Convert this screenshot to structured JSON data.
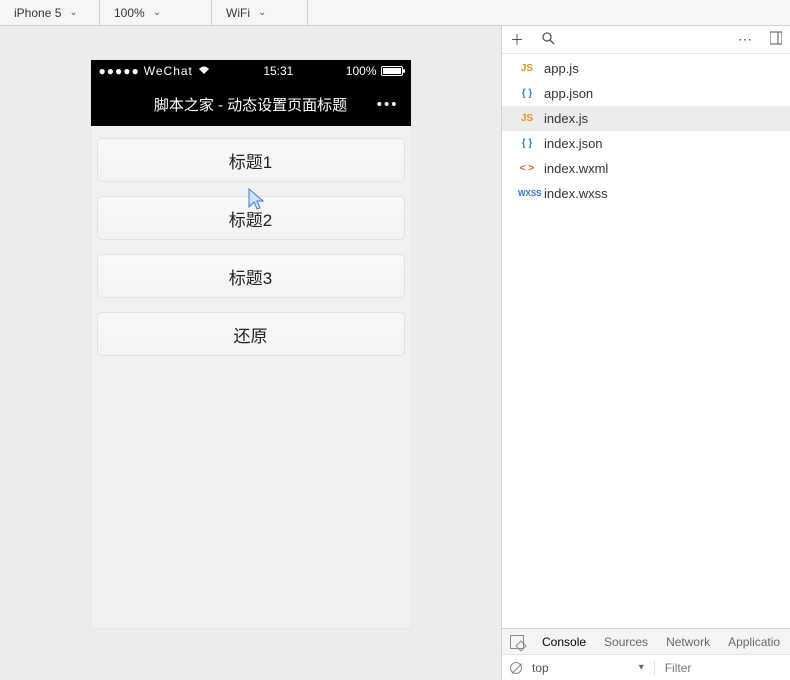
{
  "toolbar": {
    "device": "iPhone 5",
    "zoom": "100%",
    "network": "WiFi"
  },
  "statusbar": {
    "carrier": "WeChat",
    "time": "15:31",
    "battery_pct": "100%"
  },
  "navbar": {
    "title": "脚本之家 - 动态设置页面标题"
  },
  "buttons": {
    "b1": "标题1",
    "b2": "标题2",
    "b3": "标题3",
    "b4": "还原"
  },
  "files": [
    {
      "name": "app.js",
      "type": "js",
      "icon": "JS"
    },
    {
      "name": "app.json",
      "type": "json",
      "icon": "{ }"
    },
    {
      "name": "index.js",
      "type": "js",
      "icon": "JS",
      "selected": true
    },
    {
      "name": "index.json",
      "type": "json",
      "icon": "{ }"
    },
    {
      "name": "index.wxml",
      "type": "wxml",
      "icon": "< >"
    },
    {
      "name": "index.wxss",
      "type": "wxss",
      "icon": "WXSS"
    }
  ],
  "console": {
    "tabs": {
      "console": "Console",
      "sources": "Sources",
      "network": "Network",
      "application": "Applicatio"
    },
    "context": "top",
    "filter_placeholder": "Filter"
  }
}
